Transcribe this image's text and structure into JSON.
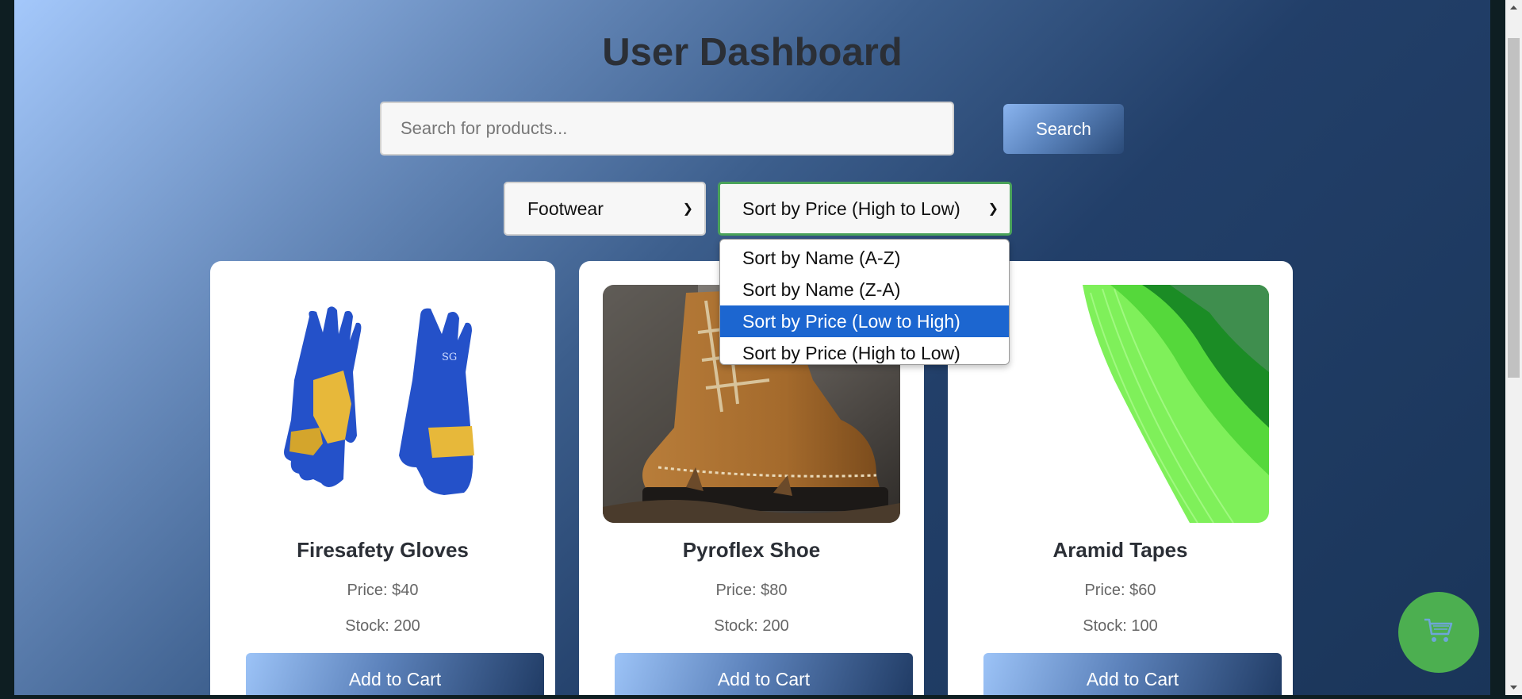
{
  "header": {
    "title": "User Dashboard"
  },
  "search": {
    "placeholder": "Search for products...",
    "button_label": "Search"
  },
  "filters": {
    "category": {
      "selected": "Footwear"
    },
    "sort": {
      "selected": "Sort by Price (High to Low)",
      "highlighted": "Sort by Price (Low to High)",
      "options": [
        "Sort by Name (A-Z)",
        "Sort by Name (Z-A)",
        "Sort by Price (Low to High)",
        "Sort by Price (High to Low)"
      ]
    }
  },
  "products": [
    {
      "name": "Firesafety Gloves",
      "price": "Price: $40",
      "stock": "Stock: 200",
      "button": "Add to Cart",
      "image_icon": "gloves-image"
    },
    {
      "name": "Pyroflex Shoe",
      "price": "Price: $80",
      "stock": "Stock: 200",
      "button": "Add to Cart",
      "image_icon": "boot-image"
    },
    {
      "name": "Aramid Tapes",
      "price": "Price: $60",
      "stock": "Stock: 100",
      "button": "Add to Cart",
      "image_icon": "tape-image"
    }
  ],
  "cart": {
    "icon": "cart-icon"
  },
  "colors": {
    "accent_green": "#4caf50",
    "dropdown_highlight": "#1c66d0",
    "title_text": "#2b2f36"
  }
}
